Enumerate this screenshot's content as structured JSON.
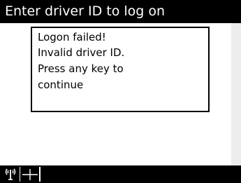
{
  "window": {
    "title": "Enter driver ID to log on"
  },
  "dialog": {
    "lines": [
      "Logon failed!",
      "Invalid driver ID.",
      "Press any key to",
      "continue"
    ]
  },
  "status_bar": {
    "icons": [
      "antenna-signal-icon",
      "gps-crosshair-icon"
    ]
  }
}
